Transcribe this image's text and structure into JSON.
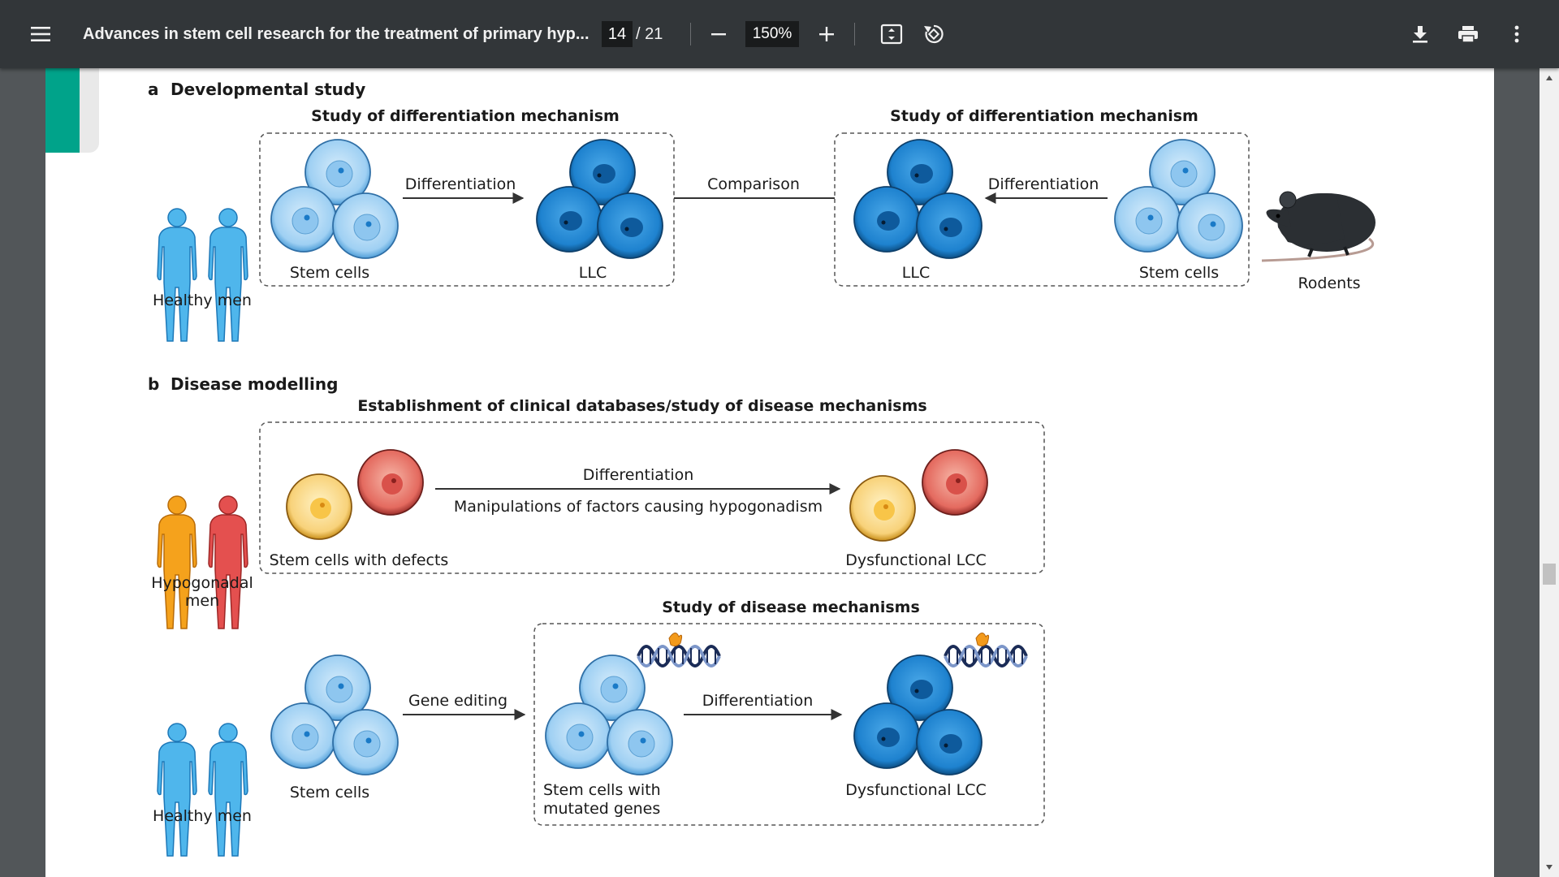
{
  "toolbar": {
    "title": "Advances in stem cell research for the treatment of primary hyp...",
    "page_current": "14",
    "page_total": "/ 21",
    "zoom": "150%",
    "icons": [
      "menu-icon",
      "minus-icon",
      "plus-icon",
      "fit-page-icon",
      "rotate-icon",
      "download-icon",
      "print-icon",
      "more-vert-icon"
    ]
  },
  "figure": {
    "panel_a": {
      "letter": "a",
      "title": "Developmental study",
      "left_box_title": "Study of differentiation mechanism",
      "right_box_title": "Study of differentiation mechanism",
      "healthy_men": "Healthy men",
      "stem_cells_left": "Stem cells",
      "differentiation_left": "Differentiation",
      "llc_left": "LLC",
      "comparison": "Comparison",
      "llc_right": "LLC",
      "differentiation_right": "Differentiation",
      "stem_cells_right": "Stem cells",
      "rodents": "Rodents"
    },
    "panel_b": {
      "letter": "b",
      "title": "Disease modelling",
      "top_box_title": "Establishment of clinical databases/study of disease mechanisms",
      "hypogonadal_men_line1": "Hypogonadal",
      "hypogonadal_men_line2": "men",
      "stem_cells_defects": "Stem cells with defects",
      "differentiation_top": "Differentiation",
      "manipulations": "Manipulations of factors causing hypogonadism",
      "dysfunctional_top": "Dysfunctional LCC",
      "bottom_box_title": "Study of disease mechanisms",
      "healthy_men": "Healthy men",
      "stem_cells": "Stem cells",
      "gene_editing": "Gene editing",
      "differentiation_bottom": "Differentiation",
      "mutated_line1": "Stem cells with",
      "mutated_line2": "mutated genes",
      "dysfunctional_bottom": "Dysfunctional LCC"
    }
  },
  "colors": {
    "toolbar_bg": "#323639",
    "viewer_bg": "#525659",
    "accent_teal": "#00a38a",
    "stem_cell_blue": "#a9d5f5",
    "llc_blue": "#2e8fd6",
    "defect_yellow": "#f7c85a",
    "defect_red": "#e56565",
    "human_blue": "#4fb6ec",
    "human_orange": "#f5a21c",
    "human_red": "#e4504f"
  }
}
